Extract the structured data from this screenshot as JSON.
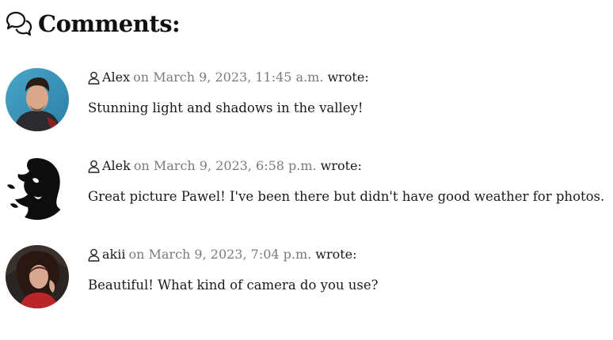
{
  "section": {
    "icon": "comments-icon",
    "title": "Comments:"
  },
  "comments": [
    {
      "author": "Alex",
      "date": "on March 9, 2023, 11:45 a.m.",
      "wrote": "wrote:",
      "text": "Stunning light and shadows in the valley!",
      "avatar": "avatar-photo-man-teal-background"
    },
    {
      "author": "Alek",
      "date": "on March 9, 2023, 6:58 p.m.",
      "wrote": "wrote:",
      "text": "Great picture Pawel! I've been there but didn't have good weather for photos.",
      "avatar": "avatar-black-white-silhouette"
    },
    {
      "author": "akii",
      "date": "on March 9, 2023, 7:04 p.m.",
      "wrote": "wrote:",
      "text": "Beautiful! What kind of camera do you use?",
      "avatar": "avatar-photo-woman-dark-hair"
    }
  ],
  "colors": {
    "text": "#1a1a1a",
    "date": "#7a7a7a",
    "background": "#ffffff"
  }
}
